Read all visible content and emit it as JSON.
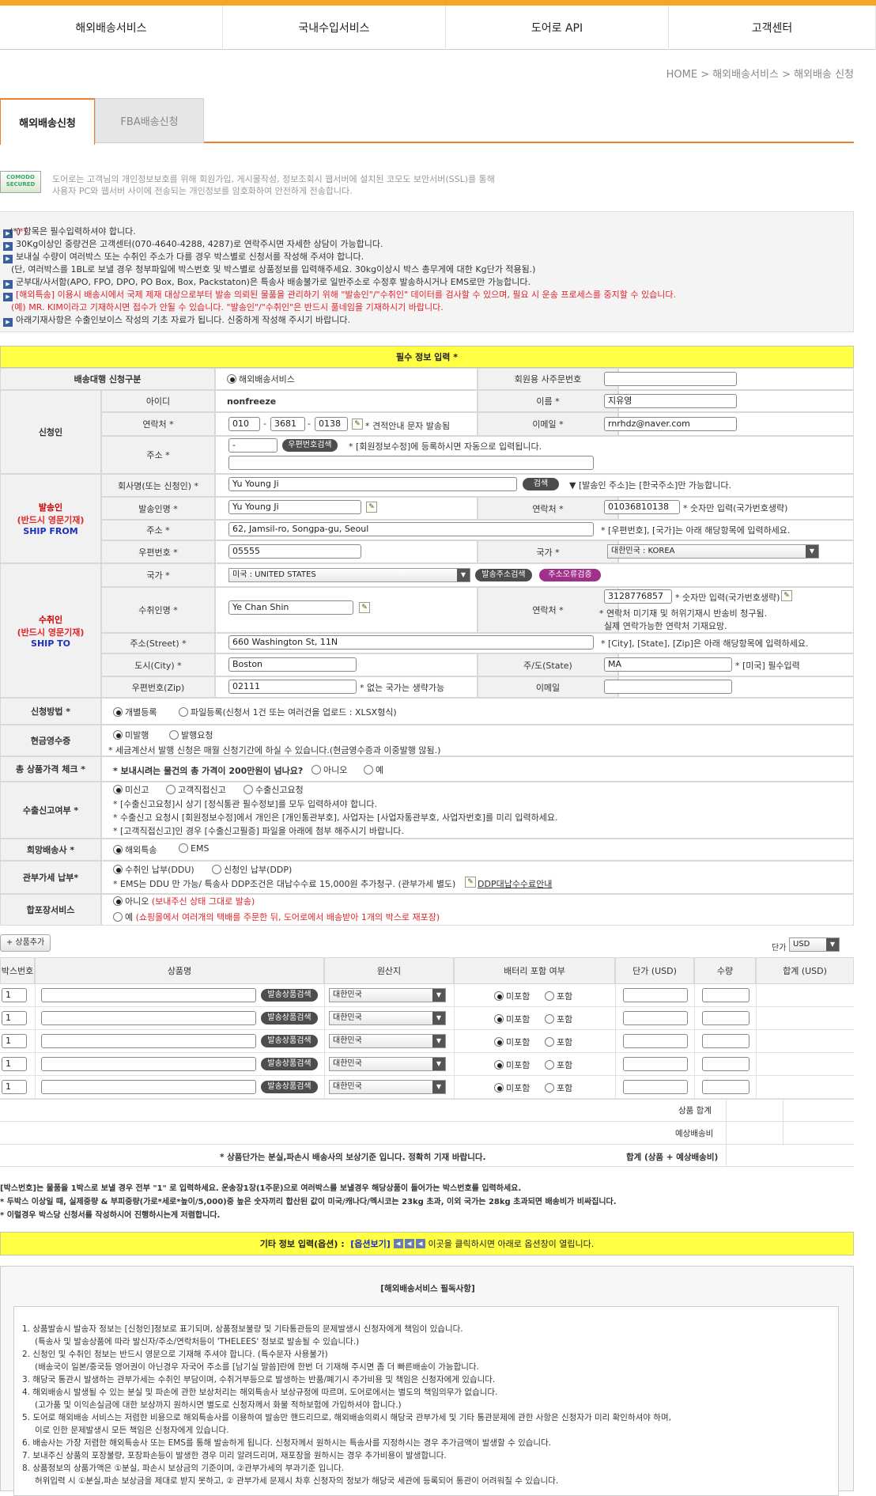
{
  "nav": {
    "items": [
      "해외배송서비스",
      "국내수입서비스",
      "도어로 API",
      "고객센터"
    ]
  },
  "breadcrumb": "HOME > 해외배송서비스 > 해외배송 신청",
  "tabs": [
    "해외배송신청",
    "FBA배송신청"
  ],
  "ssl": {
    "logo_text": "COMODO SECURED",
    "line1": "도어로는 고객님의 개인정보보호를 위해 회원가입, 게시물작성, 정보조회시 웹서버에 설치된 코모도 보안서버(SSL)를 통해",
    "line2": "사용자 PC와 웹서버 사이에 전송되는 개인정보를 암호화하여 안전하게 전송합니다."
  },
  "notices": [
    "(*) 항목은 필수입력하셔야 합니다.",
    "30Kg이상인 중량건은 고객센터(070-4640-4288, 4287)로 연락주시면 자세한 상담이 가능합니다.",
    "보내실 수량이 여러박스 또는 수취인 주소가 다를 경우 박스별로 신청서를 작성해 주셔야 합니다.",
    "(단, 여러박스를 1BL로 보낼 경우 청부파일에 박스번호 및 박스별로 상품정보를 입력해주세요. 30kg이상시 박스 총무게에 대한 Kg단가 적용됨.)",
    "군부대/사서함(APO, FPO, DPO, PO Box, Box, Packstaton)은 특송사 배송불가로 일반주소로 수정후 발송하시거나 EMS로만 가능합니다.",
    "[해외특송] 이용시 배송시에서 국제 제재 대상으로부터 발송 의뢰된 물품을 관리하기 위해 \"발송인\"/\"수취인\" 데이터를 검사할 수 있으며, 필요 시 운송 프로세스를 중지할 수 있습니다.",
    "(예) MR. KIM이라고 기재하시면 접수가 안될 수 있습니다. \"발송인\"/\"수취인\"은 반드시 풀네임을 기재하시기 바랍니다.",
    "아래기재사항은 수출인보이스 작성의 기초 자료가 됩니다. 신중하게 작성해 주시기 바랍니다."
  ],
  "required_title": "필수 정보 입력 *",
  "form": {
    "service_label": "배송대행 신청구분",
    "service_value": "해외배송서비스",
    "member_label": "회원용 사주문번호",
    "applicant_label": "신청인",
    "id_label": "아이디",
    "id_value": "nonfreeze",
    "name_label": "이름 *",
    "name_value": "지유영",
    "phone_label": "연락처 *",
    "phone1": "010",
    "phone2": "3681",
    "phone3": "0138",
    "phone_note": "* 견적안내 문자 발송됨",
    "email_label": "이메일 *",
    "email_value": "rnrhdz@naver.com",
    "addr_label": "주소 *",
    "zip_value": "-",
    "zip_btn": "우편번호검색",
    "addr_note": "* [회원정보수정]에 등록하시면 자동으로 입력됩니다.",
    "sender_label1": "발송인",
    "sender_label2": "(반드시 영문기재)",
    "sender_label3": "SHIP FROM",
    "company_label": "회사명(또는 신청인) *",
    "company_value": "Yu Young Ji",
    "search_btn": "검색",
    "company_note": "▼ [발송인 주소]는 [한국주소]만 가능합니다.",
    "sender_name_label": "발송인명 *",
    "sender_name_value": "Yu Young Ji",
    "sender_phone_label": "연락처 *",
    "sender_phone_value": "01036810138",
    "sender_phone_note": "* 숫자만 입력(국가번호생략)",
    "sender_addr_label": "주소 *",
    "sender_addr_value": "62, Jamsil-ro, Songpa-gu, Seoul",
    "sender_addr_note": "* [우편번호], [국가]는 아래 해당항목에 입력하세요.",
    "sender_zip_label": "우편번호 *",
    "sender_zip_value": "05555",
    "sender_country_label": "국가 *",
    "sender_country_value": "대한민국 : KOREA",
    "recv_label1": "수취인",
    "recv_label2": "(반드시 영문기재)",
    "recv_label3": "SHIP TO",
    "recv_country_label": "국가 *",
    "recv_country_value": "미국 : UNITED STATES",
    "recv_addr_btn": "발송주소검색",
    "recv_err_btn": "주소오류검증",
    "recv_name_label": "수취인명 *",
    "recv_name_value": "Ye Chan Shin",
    "recv_phone_label": "연락처 *",
    "recv_phone_value": "3128776857",
    "recv_phone_note1": "* 숫자만 입력(국가번호생략)",
    "recv_phone_note2": "* 연락처 미기재 및 허위기재시 반송비 청구됨.",
    "recv_phone_note3": "실제 연락가능한 연락처 기재요망.",
    "street_label": "주소(Street) *",
    "street_value": "660 Washington St, 11N",
    "street_note": "* [City], [State], [Zip]은 아래 해당항목에 입력하세요.",
    "city_label": "도시(City) *",
    "city_value": "Boston",
    "state_label": "주/도(State)",
    "state_value": "MA",
    "state_note": "* [미국] 필수입력",
    "zip_label": "우편번호(Zip)",
    "zip_value2": "02111",
    "zip_note": "* 없는 국가는 생략가능",
    "email2_label": "이메일",
    "method_label": "신청방법 *",
    "method_opt1": "개별등록",
    "method_opt2": "파일등록(신청서 1건 또는 여러건을 업로드 : XLSX형식)",
    "receipt_label": "현금영수증",
    "receipt_opt1": "미발행",
    "receipt_opt2": "발행요청",
    "receipt_note": "* 세금계산서 발행 신청은 매월 신청기간에 하실 수 있습니다.(현금영수증과 이중발행 않됨.)",
    "total_label": "총 상품가격 체크 *",
    "total_q": "* 보내시려는 물건의 총 가격이 200만원이 넘나요?",
    "total_opt1": "아니오",
    "total_opt2": "예",
    "export_label": "수출신고여부 *",
    "export_opt1": "미신고",
    "export_opt2": "고객직접신고",
    "export_opt3": "수출신고요청",
    "export_note1": "* [수출신고요청]시 상기 [정식통관 필수정보]를 모두 입력하셔야 합니다.",
    "export_note2": "* 수출신고 요청시 [회원정보수정]에서 개인은 [개인통관부호], 사업자는 [사업자통관부호, 사업자번호]를 미리 입력하세요.",
    "export_note3": "* [고객직접신고]인 경우 [수출신고필증] 파일을 아래에 첨부 해주시기 바랍니다.",
    "carrier_label": "희망배송사 *",
    "carrier_opt1": "해외특송",
    "carrier_opt2": "EMS",
    "duty_label": "관부가세 납부*",
    "duty_opt1": "수취인 납부(DDU)",
    "duty_opt2": "신청인 납부(DDP)",
    "duty_note": "* EMS는 DDU 만 가능/ 특송사 DDP조건은 대납수수료 15,000원 추가청구. (관부가세 별도)",
    "duty_link": "DDP대납수수료안내",
    "pack_label": "합포장서비스",
    "pack_opt1": "아니오",
    "pack_opt1_note": "(보내주신 상태 그대로 발송)",
    "pack_opt2": "예",
    "pack_opt2_note": "(쇼핑몰에서 여러개의 택배를 주문한 뒤, 도어로에서 배송받아 1개의 박스로 재포장)"
  },
  "products": {
    "add_btn": "+ 상품추가",
    "currency_label": "단가",
    "currency_value": "USD",
    "headers": [
      "박스번호",
      "상품명",
      "원산지",
      "배터리 포함 여부",
      "단가 (USD)",
      "수량",
      "합계 (USD)"
    ],
    "rows": [
      {
        "box": "1",
        "origin": "대한민국",
        "btn": "발송상품검색",
        "bat1": "미포함",
        "bat2": "포함"
      },
      {
        "box": "1",
        "origin": "대한민국",
        "btn": "발송상품검색",
        "bat1": "미포함",
        "bat2": "포함"
      },
      {
        "box": "1",
        "origin": "대한민국",
        "btn": "발송상품검색",
        "bat1": "미포함",
        "bat2": "포함"
      },
      {
        "box": "1",
        "origin": "대한민국",
        "btn": "발송상품검색",
        "bat1": "미포함",
        "bat2": "포함"
      },
      {
        "box": "1",
        "origin": "대한민국",
        "btn": "발송상품검색",
        "bat1": "미포함",
        "bat2": "포함"
      }
    ],
    "sum_label": "상품 합계",
    "ship_label": "예상배송비",
    "total_label": "합계 (상품 + 예상배송비)",
    "price_note": "* 상품단가는 분실,파손시 배송사의 보상기준 입니다. 정확히 기재 바랍니다."
  },
  "box_notes": [
    "[박스번호]는 물품을 1박스로 보낼 경우 전부 \"1\" 로 입력하세요. 운송장1장(1주문)으로 여러박스를 보낼경우 해당상품이 들어가는 박스번호를 입력하세요.",
    "* 두박스 이상일 때, 실제중량 & 부피중량(가로*세로*높이/5,000)중 높은 숫자끼리 합산된 값이 미국/캐나다/멕시코는 23kg 초과, 이외 국가는 28kg 초과되면 배송비가 비싸집니다.",
    "* 이럴경우 박스당 신청서를 작성하시어 진행하시는게 저렴합니다."
  ],
  "extra": {
    "label": "기타 정보 입력(옵션) :",
    "link": "[옵션보기]",
    "note": "이곳을 클릭하시면 아래로 옵션창이 열립니다."
  },
  "must_read": {
    "title": "[해외배송서비스 필독사항]",
    "items": [
      "1.  상품발송시 발송자 정보는 [신청인]정보로 표기되며, 상품정보불량 및 기타통관등의 문제발생시 신청자에게 책임이 있습니다.",
      "(특송사 및 발송상품에 따라 발신자/주소/연락처등이 'THELEES' 정보로 발송될 수 있습니다.)",
      "2.  신청인 및 수취인 정보는 반드시 영문으로 기재해 주셔야 합니다. (특수문자 사용불가)",
      "(배송국이 일본/중국등 영어권이 아닌경우 자국어 주소를 [남기실 말씀]란에 한번 더 기재해 주시면 좀 더 빠른배송이 가능합니다.",
      "3.  해당국 통관시 발생하는 관부가세는 수취인 부담이며, 수취거부등으로 발생하는 반품/폐기시 추가비용 및 책임은 신청자에게 있습니다.",
      "4.  해외배송시 발생될 수 있는 분실 및 파손에 관한 보상처리는 해외특송사 보상규정에 따르며, 도어로에서는 별도의 책임의무가 없습니다.",
      "(고가품 및 이익손실금에 대한 보상까지 원하시면 별도로 신청자께서 화물 적하보험에 가입하셔야 합니다.)",
      "5.  도어로 해외배송 서비스는 저렴한 비용으로 해외특송사를 이용하여 발송만 핸드리므로, 해외배송의뢰시 해당국 관부가세 및 기타 통관문제에 관한 사항은 신청자가 미리 확인하셔야 하며,",
      "이로 인한 문제발생시 모든 책임은 신청자에게 있습니다.",
      "6.  배송사는 가장 저렴한 해외특송사 또는 EMS를 통해 발송하게 됩니다. 신청자께서 원하시는 특송사를 지정하시는 경우 추가금액이 발생할 수 있습니다.",
      "7.  보내주신 상품의 포장불량, 포장파손등이 발생한 경우 미리 알려드리며, 재포장을 원하시는 경우 추가비용이 발생합니다.",
      "8.  상품정보의 상품가액은 ①분실, 파손시 보상금의 기준이며, ②관부가세의 부과기준 입니다.",
      "허위입력 시 ①분실,파손 보상금을 제대로 받지 못하고, ② 관부가세 문제시 차후 신청자의 정보가 해당국 세관에 등록되어 통관이 어려워질 수 있습니다."
    ]
  }
}
